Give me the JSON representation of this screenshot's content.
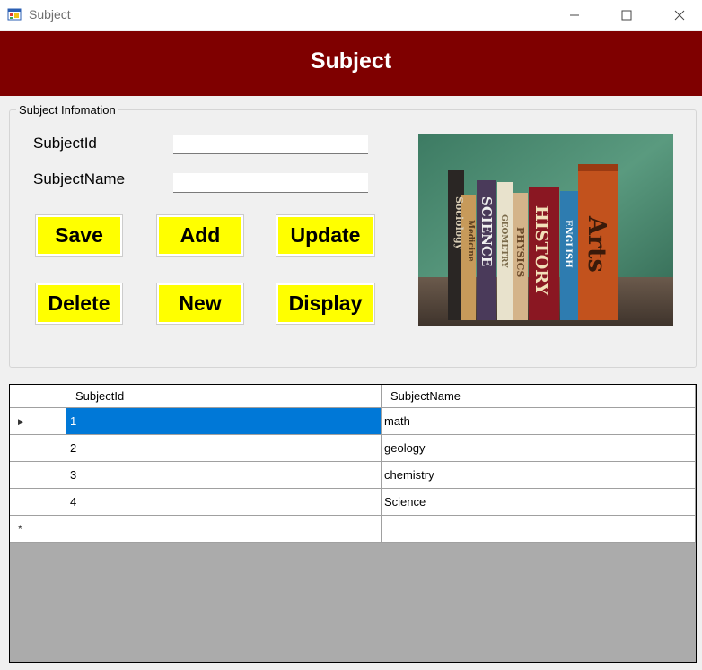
{
  "window": {
    "title": "Subject"
  },
  "header": {
    "title": "Subject"
  },
  "group": {
    "label": "Subject Infomation"
  },
  "fields": {
    "subject_id_label": "SubjectId",
    "subject_id_value": "",
    "subject_name_label": "SubjectName",
    "subject_name_value": ""
  },
  "buttons": {
    "save": "Save",
    "add": "Add",
    "update": "Update",
    "delete": "Delete",
    "new": "New",
    "display": "Display"
  },
  "image": {
    "book_titles": [
      "Sociology",
      "Medicine",
      "SCIENCE",
      "GEOMETRY",
      "PHYSICS",
      "HISTORY",
      "ENGLISH",
      "Arts"
    ]
  },
  "grid": {
    "columns": [
      "SubjectId",
      "SubjectName"
    ],
    "rows": [
      {
        "id": "1",
        "name": "math"
      },
      {
        "id": "2",
        "name": "geology"
      },
      {
        "id": "3",
        "name": "chemistry"
      },
      {
        "id": "4",
        "name": "Science"
      }
    ],
    "selected_row_index": 0,
    "current_row_marker": "▶",
    "new_row_marker": "*"
  },
  "colors": {
    "header_bg": "#7f0000",
    "button_bg": "#ffff00",
    "selection": "#0078d7",
    "grid_empty_bg": "#ababab"
  }
}
